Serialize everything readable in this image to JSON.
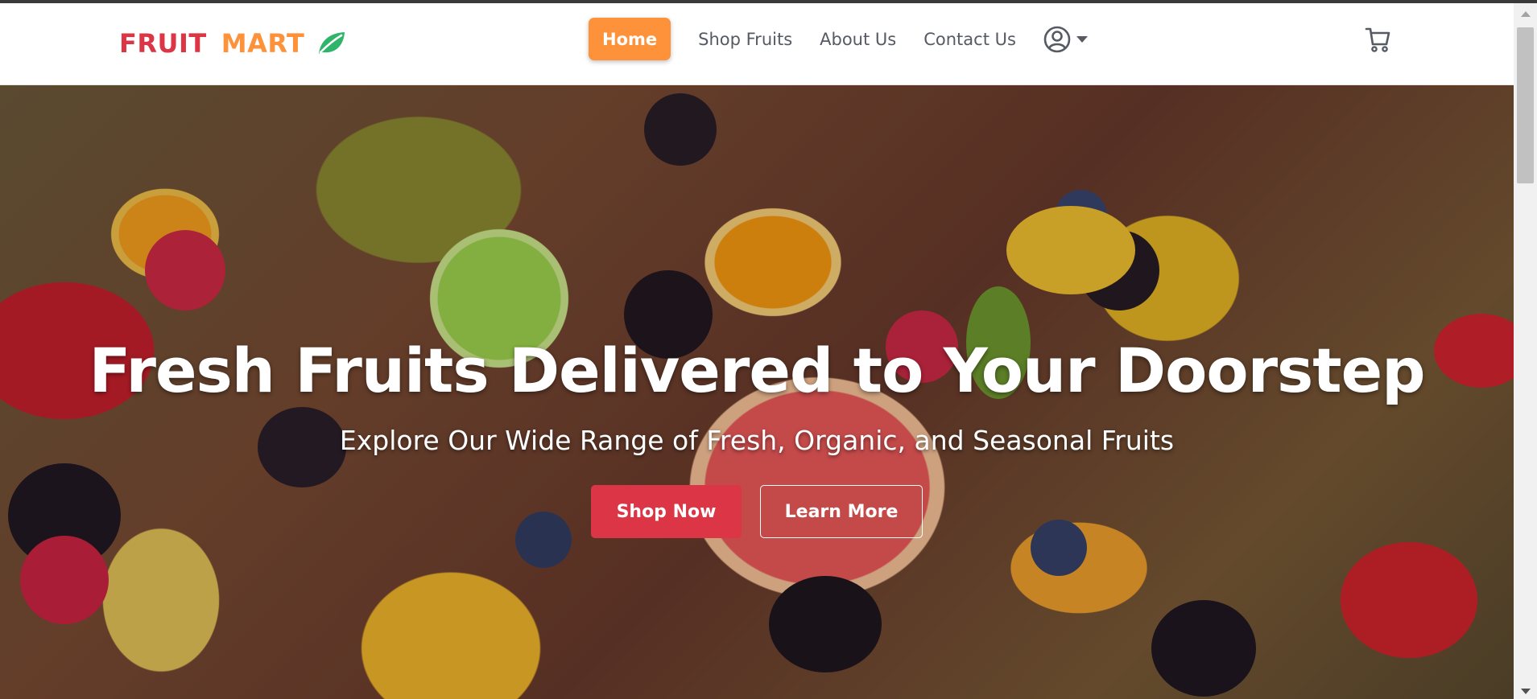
{
  "brand": {
    "word1": "FRUIT",
    "word2": "MART",
    "icon": "leaf-icon",
    "colors": {
      "word1": "#dc3545",
      "word2": "#fd923a",
      "leaf": "#2fb56a"
    }
  },
  "nav": {
    "items": [
      {
        "label": "Home",
        "active": true
      },
      {
        "label": "Shop Fruits",
        "active": false
      },
      {
        "label": "About Us",
        "active": false
      },
      {
        "label": "Contact Us",
        "active": false
      }
    ],
    "user_icon": "user-circle-icon",
    "dropdown_icon": "caret-down-icon",
    "cart_icon": "cart-icon",
    "accent": "#fd923a"
  },
  "hero": {
    "title": "Fresh Fruits Delivered to Your Doorstep",
    "subtitle": "Explore Our Wide Range of Fresh, Organic, and Seasonal Fruits",
    "primary_button": "Shop Now",
    "secondary_button": "Learn More",
    "primary_color": "#dc3545",
    "background": "fruit-platter-image"
  }
}
